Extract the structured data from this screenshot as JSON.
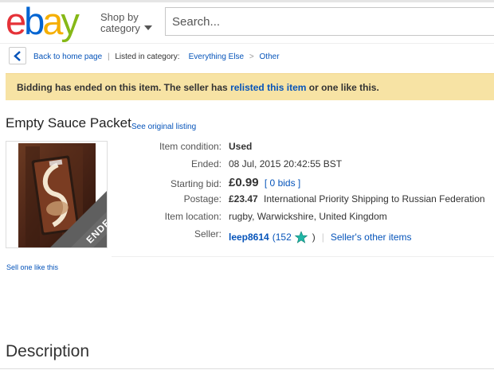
{
  "header": {
    "logo": {
      "letters": [
        "e",
        "b",
        "a",
        "y"
      ],
      "colors": [
        "#e53238",
        "#0064d2",
        "#f5af02",
        "#86b817"
      ]
    },
    "shop_by_line1": "Shop by",
    "shop_by_line2": "category",
    "search_placeholder": "Search..."
  },
  "breadcrumb": {
    "back": "Back to home page",
    "divider": "|",
    "listed_in": "Listed in category:",
    "category1": "Everything Else",
    "arrow": ">",
    "category2": "Other"
  },
  "notice": {
    "text_before": "Bidding has ended on this item. The seller has ",
    "link": "relisted this item",
    "text_after": " or one like this.",
    "background": "#f7e3a4"
  },
  "listing": {
    "title": "Empty Sauce Packet",
    "see_original": "See original listing",
    "ended_badge": "ENDED"
  },
  "details": {
    "condition_label": "Item condition:",
    "condition_value": "Used",
    "ended_label": "Ended:",
    "ended_value": "08 Jul, 2015  20:42:55 BST",
    "starting_bid_label": "Starting bid:",
    "starting_bid_value": "£0.99",
    "bids_link": "[ 0 bids ]",
    "postage_label": "Postage:",
    "postage_price": "£23.47",
    "postage_desc": "International Priority Shipping to Russian Federation",
    "location_label": "Item location:",
    "location_value": "rugby, Warwickshire, United Kingdom",
    "seller_label": "Seller:",
    "seller_name": "leep8614",
    "seller_score_open": "(152",
    "seller_score_close": ")",
    "seller_sep": "|",
    "seller_other": "Seller's other items"
  },
  "sell_one": "Sell one like this",
  "description_heading": "Description",
  "colors": {
    "link": "#0654ba",
    "star": "#1fb7a6"
  }
}
